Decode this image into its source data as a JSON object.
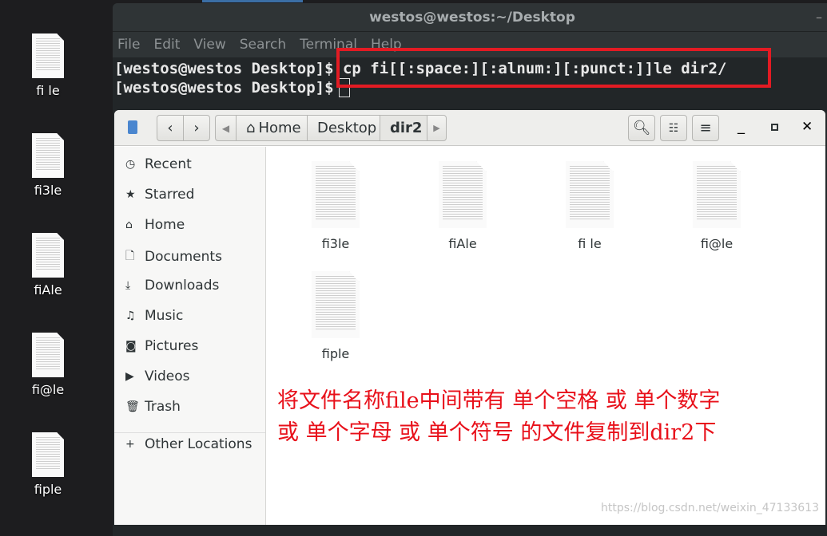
{
  "desktop": {
    "icons": [
      {
        "label": "fi le"
      },
      {
        "label": "fi3le"
      },
      {
        "label": "fiAle"
      },
      {
        "label": "fi@le"
      },
      {
        "label": "fiple"
      }
    ]
  },
  "terminal": {
    "title": "westos@westos:~/Desktop",
    "menu": [
      "File",
      "Edit",
      "View",
      "Search",
      "Terminal",
      "Help"
    ],
    "lines": [
      "[westos@westos Desktop]$ cp fi[[:space:][:alnum:][:punct:]]le dir2/",
      "[westos@westos Desktop]$"
    ]
  },
  "files": {
    "breadcrumb": [
      "Home",
      "Desktop",
      "dir2"
    ],
    "sidebar": [
      {
        "label": "Recent",
        "icon": "clock-icon"
      },
      {
        "label": "Starred",
        "icon": "star-icon"
      },
      {
        "label": "Home",
        "icon": "home-icon"
      },
      {
        "label": "Documents",
        "icon": "document-icon"
      },
      {
        "label": "Downloads",
        "icon": "download-icon"
      },
      {
        "label": "Music",
        "icon": "music-icon"
      },
      {
        "label": "Pictures",
        "icon": "camera-icon"
      },
      {
        "label": "Videos",
        "icon": "video-icon"
      },
      {
        "label": "Trash",
        "icon": "trash-icon"
      },
      {
        "label": "Other Locations",
        "icon": "plus-icon"
      }
    ],
    "items": [
      {
        "label": "fi3le"
      },
      {
        "label": "fiAle"
      },
      {
        "label": "fi le"
      },
      {
        "label": "fi@le"
      },
      {
        "label": "fiple"
      }
    ]
  },
  "annotation": {
    "line1": "将文件名称file中间带有 单个空格 或 单个数字",
    "line2": "或 单个字母 或 单个符号 的文件复制到dir2下",
    "color": "#e8101a"
  },
  "watermark": "https://blog.csdn.net/weixin_47133613"
}
